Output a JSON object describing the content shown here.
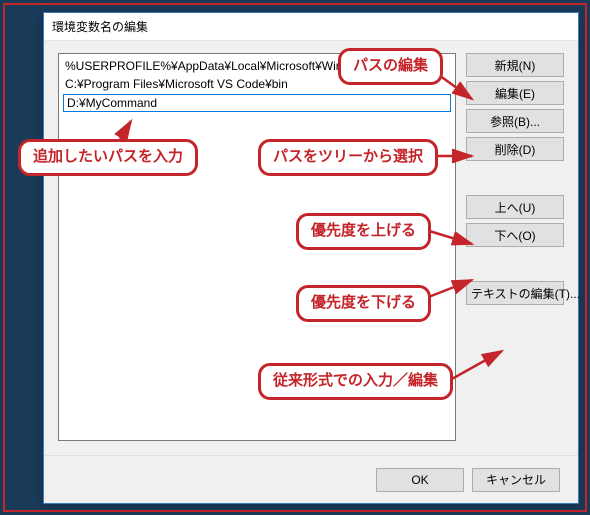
{
  "dialog": {
    "title": "環境変数名の編集"
  },
  "listbox": {
    "rows": [
      "%USERPROFILE%¥AppData¥Local¥Microsoft¥WindowsApps",
      "C:¥Program Files¥Microsoft VS Code¥bin"
    ],
    "editing_value": "D:¥MyCommand"
  },
  "buttons": {
    "new": "新規(N)",
    "edit": "編集(E)",
    "browse": "参照(B)...",
    "delete": "削除(D)",
    "up": "上へ(U)",
    "down": "下へ(O)",
    "edit_text": "テキストの編集(T)...",
    "ok": "OK",
    "cancel": "キャンセル"
  },
  "annotations": {
    "edit_path": "パスの編集",
    "add_path": "追加したいパスを入力",
    "select_tree": "パスをツリーから選択",
    "priority_up": "優先度を上げる",
    "priority_down": "優先度を下げる",
    "legacy_edit": "従来形式での入力／編集"
  }
}
